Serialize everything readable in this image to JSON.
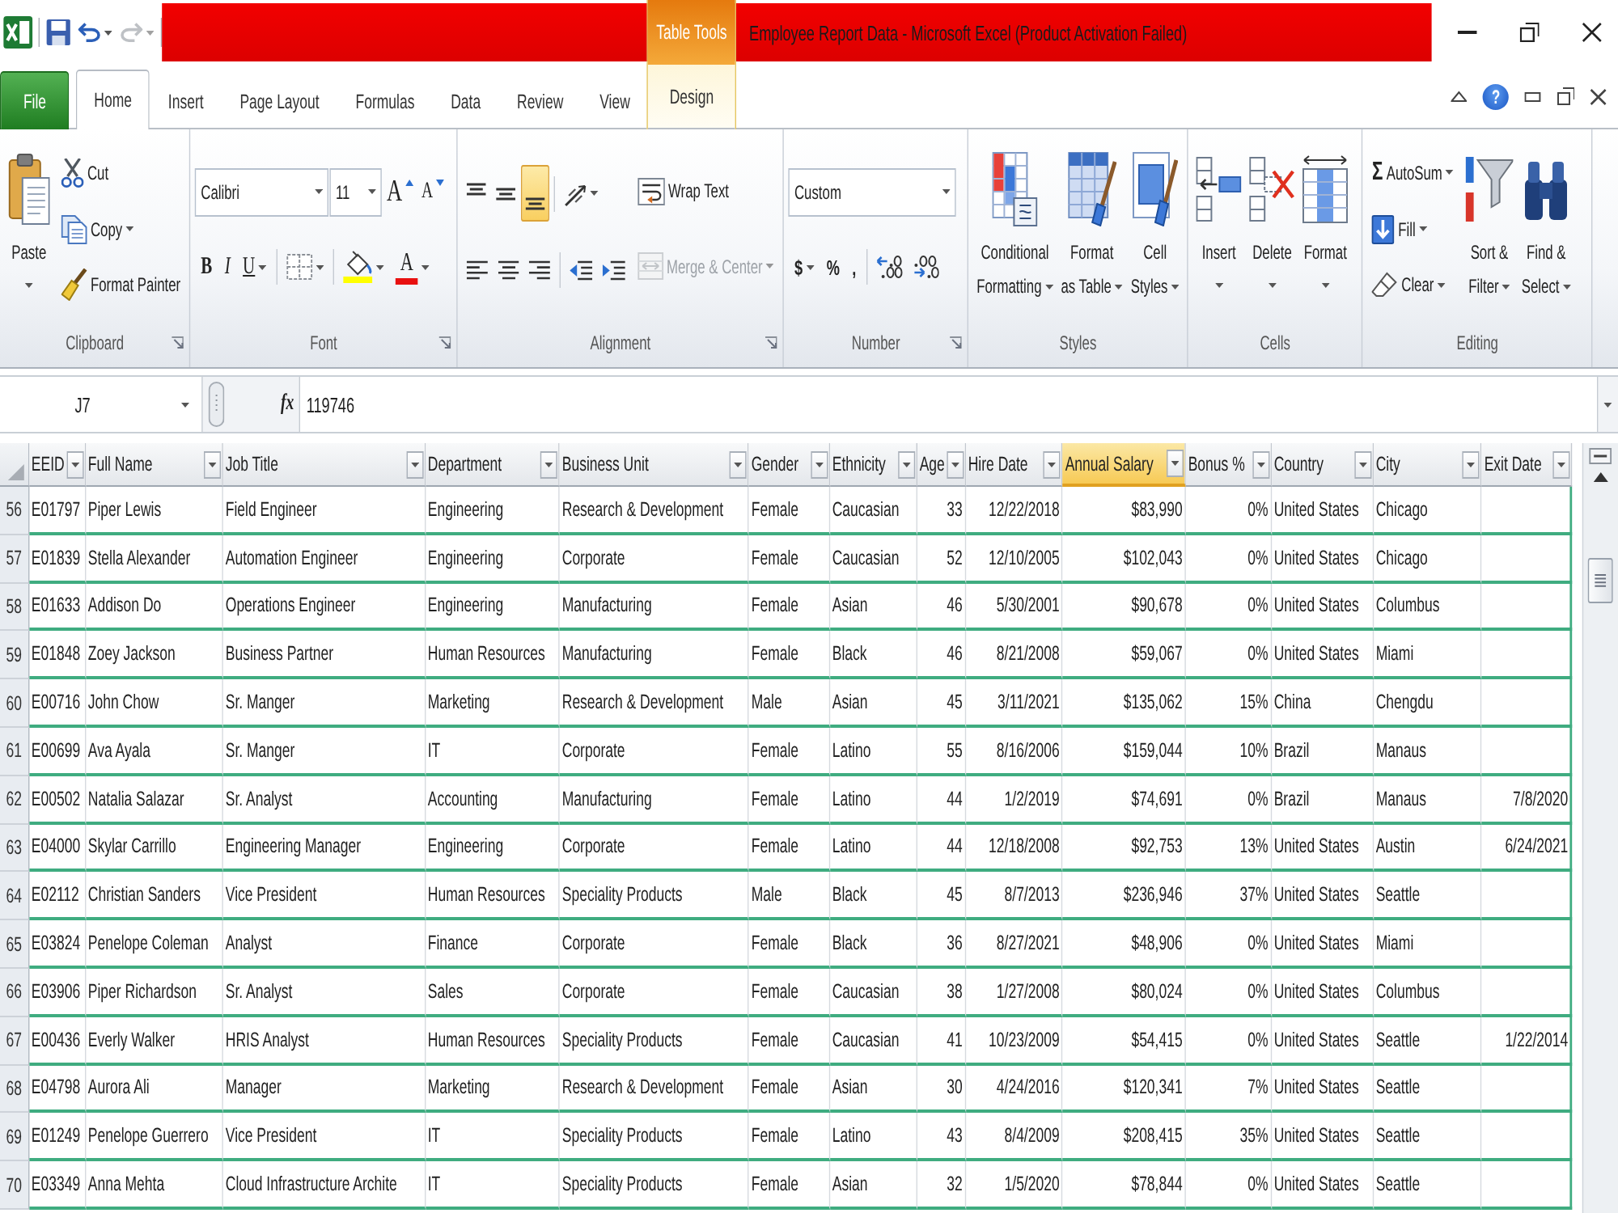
{
  "window": {
    "title": "Employee Report Data - Microsoft Excel (Product Activation Failed)",
    "contextual_group": "Table Tools"
  },
  "quick_access": [
    {
      "disabled": false,
      "dropdown": false
    },
    {
      "disabled": false,
      "dropdown": true
    },
    {
      "disabled": true,
      "dropdown": true
    }
  ],
  "ribbon_tabs": [
    {
      "label": "File",
      "kind": "backstage",
      "selected": false
    },
    {
      "label": "Home",
      "kind": "tab",
      "selected": true
    },
    {
      "label": "Insert",
      "kind": "tab",
      "selected": false
    },
    {
      "label": "Page Layout",
      "kind": "tab",
      "selected": false
    },
    {
      "label": "Formulas",
      "kind": "tab",
      "selected": false
    },
    {
      "label": "Data",
      "kind": "tab",
      "selected": false
    },
    {
      "label": "Review",
      "kind": "tab",
      "selected": false
    },
    {
      "label": "View",
      "kind": "tab",
      "selected": false
    },
    {
      "label": "Design",
      "kind": "contextual",
      "selected": false
    }
  ],
  "help_button": "?",
  "ribbon_groups": [
    {
      "label": "Clipboard",
      "launcher": true,
      "stacks": [
        {
          "kind": "large",
          "items": [
            {
              "kind": "large",
              "label": "Paste",
              "dropdown": true
            }
          ]
        },
        {
          "kind": "rows",
          "rows": [
            {
              "controls": [
                {
                  "kind": "button",
                  "label": "Cut",
                  "dropdown": false
                }
              ]
            },
            {
              "controls": [
                {
                  "kind": "button",
                  "label": "Copy",
                  "dropdown": true
                }
              ]
            },
            {
              "controls": [
                {
                  "kind": "button",
                  "label": "Format Painter",
                  "dropdown": false
                }
              ]
            }
          ]
        }
      ]
    },
    {
      "label": "Font",
      "launcher": true,
      "stacks": [
        {
          "kind": "rows",
          "rows": [
            {
              "controls": [
                {
                  "kind": "combo",
                  "value": "Calibri"
                },
                {
                  "kind": "combo",
                  "value": "11"
                },
                {
                  "kind": "grow",
                  "glyph": "A"
                },
                {
                  "kind": "shrink",
                  "glyph": "A"
                }
              ]
            },
            {
              "controls": [
                {
                  "kind": "bold",
                  "glyph": "B",
                  "dropdown": false
                },
                {
                  "kind": "italic",
                  "glyph": "I",
                  "dropdown": false
                },
                {
                  "kind": "underline",
                  "glyph": "U",
                  "dropdown": true
                },
                {
                  "kind": "icon",
                  "dropdown": true
                },
                {
                  "kind": "icon",
                  "dropdown": true
                },
                {
                  "kind": "fontcolor",
                  "glyph": "A",
                  "dropdown": true
                }
              ]
            }
          ]
        }
      ]
    },
    {
      "label": "Alignment",
      "launcher": true,
      "stacks": [
        {
          "kind": "rows",
          "rows": [
            {
              "controls": [
                {
                  "kind": "icon",
                  "selected": false
                },
                {
                  "kind": "icon",
                  "selected": false
                },
                {
                  "kind": "icon",
                  "selected": true
                },
                {
                  "kind": "icon",
                  "dropdown": true
                }
              ]
            },
            {
              "controls": [
                {
                  "kind": "icon",
                  "selected": false
                },
                {
                  "kind": "icon",
                  "selected": false
                },
                {
                  "kind": "icon",
                  "selected": false
                },
                {
                  "kind": "icon"
                },
                {
                  "kind": "icon"
                }
              ]
            }
          ]
        },
        {
          "kind": "rows",
          "rows": [
            {
              "controls": [
                {
                  "kind": "button",
                  "label": "Wrap Text",
                  "disabled": false
                }
              ]
            },
            {
              "controls": [
                {
                  "kind": "button",
                  "label": "Merge & Center",
                  "dropdown": true,
                  "disabled": true
                }
              ]
            }
          ]
        }
      ]
    },
    {
      "label": "Number",
      "launcher": true,
      "stacks": [
        {
          "kind": "rows",
          "rows": [
            {
              "controls": [
                {
                  "kind": "combo",
                  "value": "Custom"
                }
              ]
            },
            {
              "controls": [
                {
                  "kind": "glyph",
                  "glyph": "$",
                  "dropdown": true
                },
                {
                  "kind": "glyph",
                  "glyph": "%"
                },
                {
                  "kind": "glyph",
                  "glyph": ","
                },
                {
                  "kind": "icon"
                },
                {
                  "kind": "icon"
                }
              ]
            }
          ]
        }
      ]
    },
    {
      "label": "Styles",
      "launcher": false,
      "stacks": [
        {
          "kind": "large",
          "items": [
            {
              "kind": "large",
              "label": "Conditional\nFormatting",
              "dropdown": true
            },
            {
              "kind": "large",
              "label": "Format\nas Table",
              "dropdown": true
            },
            {
              "kind": "large",
              "label": "Cell\nStyles",
              "dropdown": true
            }
          ]
        }
      ]
    },
    {
      "label": "Cells",
      "launcher": false,
      "stacks": [
        {
          "kind": "large",
          "items": [
            {
              "kind": "large",
              "label": "Insert",
              "dropdown": true
            },
            {
              "kind": "large",
              "label": "Delete",
              "dropdown": true
            },
            {
              "kind": "large",
              "label": "Format",
              "dropdown": true
            }
          ]
        }
      ]
    },
    {
      "label": "Editing",
      "launcher": false,
      "stacks": [
        {
          "kind": "rows",
          "rows": [
            {
              "controls": [
                {
                  "kind": "sum",
                  "glyph": "Σ",
                  "label": "AutoSum",
                  "dropdown": true
                }
              ]
            },
            {
              "controls": [
                {
                  "kind": "button",
                  "label": "Fill",
                  "dropdown": true
                }
              ]
            },
            {
              "controls": [
                {
                  "kind": "button",
                  "label": "Clear",
                  "dropdown": true
                }
              ]
            }
          ]
        },
        {
          "kind": "large",
          "items": [
            {
              "kind": "large",
              "label": "Sort &\nFilter",
              "dropdown": true
            },
            {
              "kind": "large",
              "label": "Find &\nSelect",
              "dropdown": true
            }
          ]
        }
      ]
    }
  ],
  "formula_bar": {
    "name_box": "J7",
    "function_button": "fx",
    "value": "119746"
  },
  "table": {
    "columns": [
      {
        "label": "EEID",
        "kind": "text",
        "selected": false
      },
      {
        "label": "Full Name",
        "kind": "text",
        "selected": false
      },
      {
        "label": "Job Title",
        "kind": "text",
        "selected": false
      },
      {
        "label": "Department",
        "kind": "text",
        "selected": false
      },
      {
        "label": "Business Unit",
        "kind": "text",
        "selected": false
      },
      {
        "label": "Gender",
        "kind": "text",
        "selected": false
      },
      {
        "label": "Ethnicity",
        "kind": "text",
        "selected": false
      },
      {
        "label": "Age",
        "kind": "number",
        "selected": false
      },
      {
        "label": "Hire Date",
        "kind": "number",
        "selected": false
      },
      {
        "label": "Annual Salary",
        "kind": "number",
        "selected": true
      },
      {
        "label": "Bonus %",
        "kind": "number",
        "selected": false
      },
      {
        "label": "Country",
        "kind": "text",
        "selected": false
      },
      {
        "label": "City",
        "kind": "text",
        "selected": false
      },
      {
        "label": "Exit Date",
        "kind": "number",
        "selected": false
      }
    ],
    "rows": [
      {
        "number": "56",
        "cells": [
          "E01797",
          "Piper Lewis",
          "Field Engineer",
          "Engineering",
          "Research & Development",
          "Female",
          "Caucasian",
          "33",
          "12/22/2018",
          "$83,990",
          "0%",
          "United States",
          "Chicago"
        ]
      },
      {
        "number": "57",
        "cells": [
          "E01839",
          "Stella Alexander",
          "Automation Engineer",
          "Engineering",
          "Corporate",
          "Female",
          "Caucasian",
          "52",
          "12/10/2005",
          "$102,043",
          "0%",
          "United States",
          "Chicago"
        ]
      },
      {
        "number": "58",
        "cells": [
          "E01633",
          "Addison Do",
          "Operations Engineer",
          "Engineering",
          "Manufacturing",
          "Female",
          "Asian",
          "46",
          "5/30/2001",
          "$90,678",
          "0%",
          "United States",
          "Columbus"
        ]
      },
      {
        "number": "59",
        "cells": [
          "E01848",
          "Zoey Jackson",
          "Business Partner",
          "Human Resources",
          "Manufacturing",
          "Female",
          "Black",
          "46",
          "8/21/2008",
          "$59,067",
          "0%",
          "United States",
          "Miami"
        ]
      },
      {
        "number": "60",
        "cells": [
          "E00716",
          "John Chow",
          "Sr. Manger",
          "Marketing",
          "Research & Development",
          "Male",
          "Asian",
          "45",
          "3/11/2021",
          "$135,062",
          "15%",
          "China",
          "Chengdu"
        ]
      },
      {
        "number": "61",
        "cells": [
          "E00699",
          "Ava Ayala",
          "Sr. Manger",
          "IT",
          "Corporate",
          "Female",
          "Latino",
          "55",
          "8/16/2006",
          "$159,044",
          "10%",
          "Brazil",
          "Manaus"
        ]
      },
      {
        "number": "62",
        "cells": [
          "E00502",
          "Natalia Salazar",
          "Sr. Analyst",
          "Accounting",
          "Manufacturing",
          "Female",
          "Latino",
          "44",
          "1/2/2019",
          "$74,691",
          "0%",
          "Brazil",
          "Manaus",
          "7/8/2020"
        ]
      },
      {
        "number": "63",
        "cells": [
          "E04000",
          "Skylar Carrillo",
          "Engineering Manager",
          "Engineering",
          "Corporate",
          "Female",
          "Latino",
          "44",
          "12/18/2008",
          "$92,753",
          "13%",
          "United States",
          "Austin",
          "6/24/2021"
        ]
      },
      {
        "number": "64",
        "cells": [
          "E02112",
          "Christian Sanders",
          "Vice President",
          "Human Resources",
          "Speciality Products",
          "Male",
          "Black",
          "45",
          "8/7/2013",
          "$236,946",
          "37%",
          "United States",
          "Seattle"
        ]
      },
      {
        "number": "65",
        "cells": [
          "E03824",
          "Penelope Coleman",
          "Analyst",
          "Finance",
          "Corporate",
          "Female",
          "Black",
          "36",
          "8/27/2021",
          "$48,906",
          "0%",
          "United States",
          "Miami"
        ]
      },
      {
        "number": "66",
        "cells": [
          "E03906",
          "Piper Richardson",
          "Sr. Analyst",
          "Sales",
          "Corporate",
          "Female",
          "Caucasian",
          "38",
          "1/27/2008",
          "$80,024",
          "0%",
          "United States",
          "Columbus"
        ]
      },
      {
        "number": "67",
        "cells": [
          "E00436",
          "Everly Walker",
          "HRIS Analyst",
          "Human Resources",
          "Speciality Products",
          "Female",
          "Caucasian",
          "41",
          "10/23/2009",
          "$54,415",
          "0%",
          "United States",
          "Seattle",
          "1/22/2014"
        ]
      },
      {
        "number": "68",
        "cells": [
          "E04798",
          "Aurora Ali",
          "Manager",
          "Marketing",
          "Research & Development",
          "Female",
          "Asian",
          "30",
          "4/24/2016",
          "$120,341",
          "7%",
          "United States",
          "Seattle"
        ]
      },
      {
        "number": "69",
        "cells": [
          "E01249",
          "Penelope Guerrero",
          "Vice President",
          "IT",
          "Speciality Products",
          "Female",
          "Latino",
          "43",
          "8/4/2009",
          "$208,415",
          "35%",
          "United States",
          "Seattle"
        ]
      },
      {
        "number": "70",
        "cells": [
          "E03349",
          "Anna Mehta",
          "Cloud Infrastructure Archite",
          "IT",
          "Speciality Products",
          "Female",
          "Asian",
          "32",
          "1/5/2020",
          "$78,844",
          "0%",
          "United States",
          "Seattle"
        ]
      }
    ]
  }
}
